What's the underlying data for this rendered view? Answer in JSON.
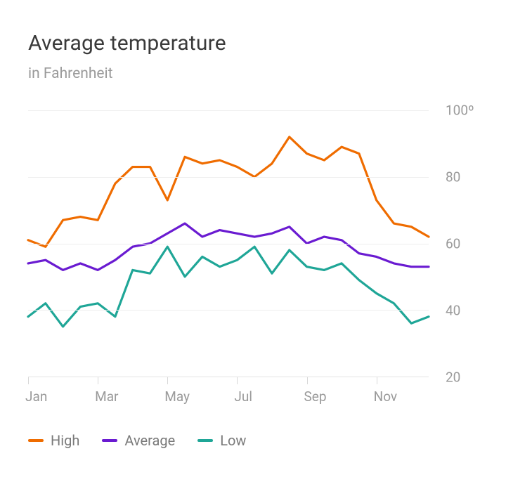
{
  "header": {
    "title": "Average temperature",
    "subtitle": "in Fahrenheit"
  },
  "chart_data": {
    "type": "line",
    "title": "Average temperature",
    "subtitle": "in Fahrenheit",
    "xlabel": "",
    "ylabel": "",
    "ylim": [
      20,
      100
    ],
    "y_ticks": [
      20,
      40,
      60,
      80,
      100
    ],
    "y_tick_labels": [
      "20",
      "40",
      "60",
      "80",
      "100º"
    ],
    "x_tick_positions": [
      0,
      4,
      8,
      12,
      16,
      20
    ],
    "x_tick_labels": [
      "Jan",
      "Mar",
      "May",
      "Jul",
      "Sep",
      "Nov"
    ],
    "x": [
      0,
      1,
      2,
      3,
      4,
      5,
      6,
      7,
      8,
      9,
      10,
      11,
      12,
      13,
      14,
      15,
      16,
      17,
      18,
      19,
      20,
      21,
      22,
      23
    ],
    "series": [
      {
        "name": "High",
        "color": "#ef6c00",
        "values": [
          61,
          59,
          67,
          68,
          67,
          78,
          83,
          83,
          73,
          86,
          84,
          85,
          83,
          80,
          84,
          92,
          87,
          85,
          89,
          87,
          73,
          66,
          65,
          62
        ]
      },
      {
        "name": "Average",
        "color": "#6a1bd1",
        "values": [
          54,
          55,
          52,
          54,
          52,
          55,
          59,
          60,
          63,
          66,
          62,
          64,
          63,
          62,
          63,
          65,
          60,
          62,
          61,
          57,
          56,
          54,
          53,
          53
        ]
      },
      {
        "name": "Low",
        "color": "#1fa697",
        "values": [
          38,
          42,
          35,
          41,
          42,
          38,
          52,
          51,
          59,
          50,
          56,
          53,
          55,
          59,
          51,
          58,
          53,
          52,
          54,
          49,
          45,
          42,
          36,
          38
        ]
      }
    ],
    "legend_position": "bottom",
    "grid": true
  },
  "legend": {
    "items": [
      {
        "label": "High",
        "color": "#ef6c00"
      },
      {
        "label": "Average",
        "color": "#6a1bd1"
      },
      {
        "label": "Low",
        "color": "#1fa697"
      }
    ]
  }
}
